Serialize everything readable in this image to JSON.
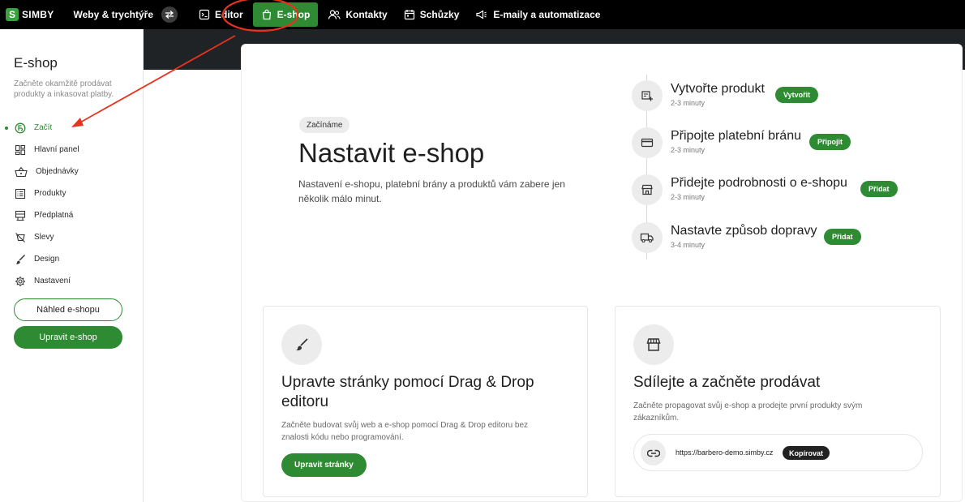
{
  "topbar": {
    "logo_mark": "S",
    "logo_text": "SIMBY",
    "site_name": "Weby & trychtýře",
    "nav": [
      {
        "label": "Editor",
        "icon": "editor-icon",
        "active": false
      },
      {
        "label": "E-shop",
        "icon": "shopping-bag-icon",
        "active": true
      },
      {
        "label": "Kontakty",
        "icon": "contacts-icon",
        "active": false
      },
      {
        "label": "Schůzky",
        "icon": "calendar-icon",
        "active": false
      },
      {
        "label": "E-maily a automatizace",
        "icon": "megaphone-icon",
        "active": false
      }
    ]
  },
  "sidebar": {
    "title": "E-shop",
    "description": "Začněte okamžitě prodávat produkty a inkasovat platby.",
    "items": [
      {
        "label": "Začít",
        "icon": "start-icon",
        "active": true
      },
      {
        "label": "Hlavní panel",
        "icon": "dashboard-icon",
        "active": false
      },
      {
        "label": "Objednávky",
        "icon": "basket-icon",
        "active": false
      },
      {
        "label": "Produkty",
        "icon": "products-list-icon",
        "active": false
      },
      {
        "label": "Předplatná",
        "icon": "subscriptions-icon",
        "active": false
      },
      {
        "label": "Slevy",
        "icon": "discount-icon",
        "active": false
      },
      {
        "label": "Design",
        "icon": "brush-icon",
        "active": false
      },
      {
        "label": "Nastavení",
        "icon": "gear-icon",
        "active": false
      }
    ],
    "preview_button": "Náhled e-shopu",
    "edit_button": "Upravit e-shop"
  },
  "hero": {
    "chip": "Začínáme",
    "title": "Nastavit e-shop",
    "description": "Nastavení e-shopu, platební brány a produktů vám zabere jen několik málo minut."
  },
  "steps": [
    {
      "title": "Vytvořte produkt",
      "duration": "2-3 minuty",
      "action": "Vytvořit",
      "icon": "add-product-icon"
    },
    {
      "title": "Připojte platební bránu",
      "duration": "2-3 minuty",
      "action": "Připojit",
      "icon": "credit-card-icon"
    },
    {
      "title": "Přidejte podrobnosti o e-shopu",
      "duration": "2-3 minuty",
      "action": "Přidat",
      "icon": "store-icon"
    },
    {
      "title": "Nastavte způsob dopravy",
      "duration": "3-4 minuty",
      "action": "Přidat",
      "icon": "truck-icon"
    }
  ],
  "cards": {
    "editor": {
      "title": "Upravte stránky pomocí Drag & Drop editoru",
      "description": "Začněte budovat svůj web a e-shop pomocí Drag & Drop editoru bez znalosti kódu nebo programování.",
      "button": "Upravit stránky"
    },
    "share": {
      "title": "Sdílejte a začněte prodávat",
      "description": "Začněte propagovat svůj e-shop a prodejte první produkty svým zákazníkům.",
      "url": "https://barbero-demo.simby.cz",
      "copy_button": "Kopírovat"
    }
  },
  "colors": {
    "accent": "#2e8b33",
    "topbar": "#000000",
    "annotation": "#e8321f"
  }
}
